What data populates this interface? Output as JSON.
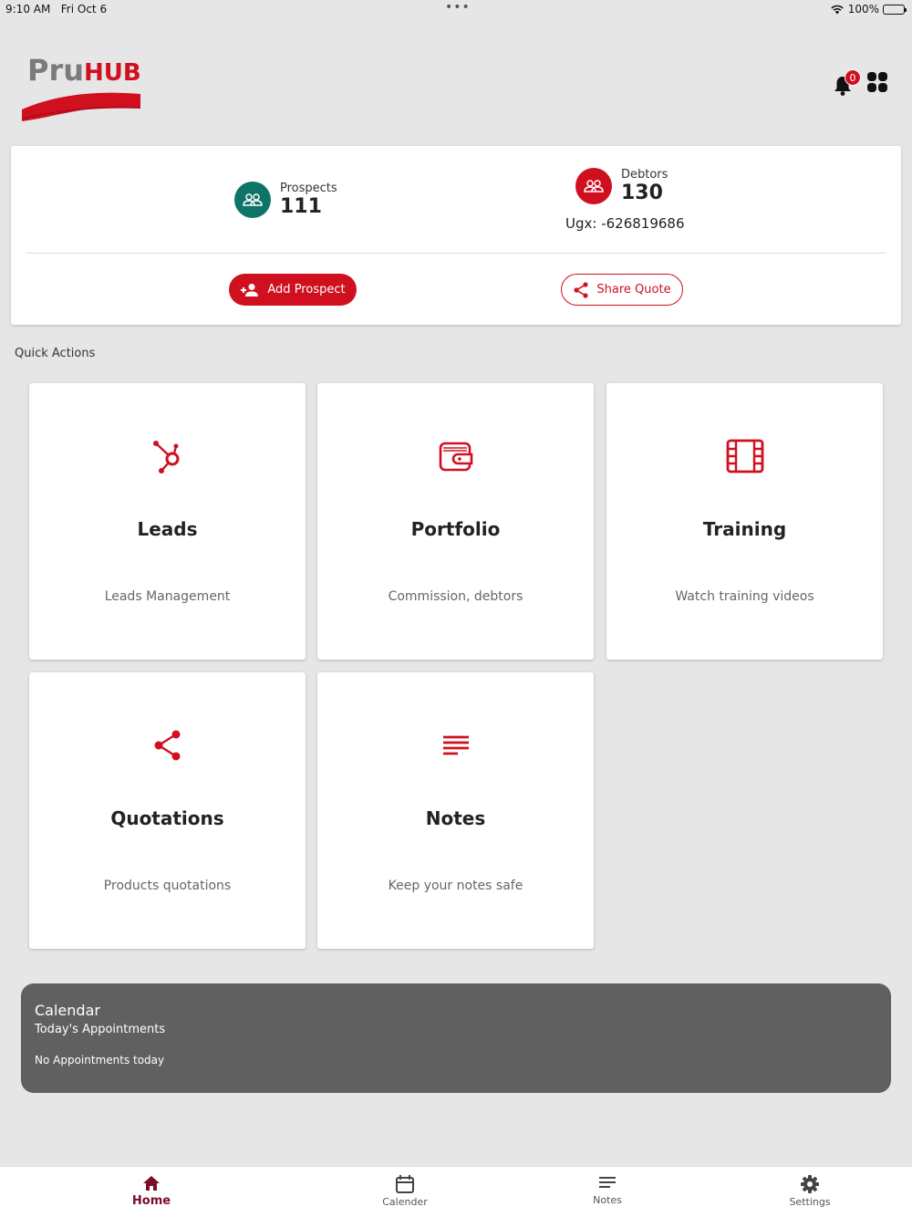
{
  "status_bar": {
    "time": "9:10 AM",
    "date": "Fri Oct 6",
    "battery": "100%",
    "dots": "•••"
  },
  "brand": {
    "part1": "Pru",
    "part2": "HUB",
    "accent": "#d0101f"
  },
  "notifications": {
    "count": "0"
  },
  "summary": {
    "prospects": {
      "label": "Prospects",
      "value": "111",
      "color": "#0e7467"
    },
    "debtors": {
      "label": "Debtors",
      "value": "130",
      "color": "#d0101f",
      "amount": "Ugx: -626819686"
    },
    "add_prospect_label": "Add Prospect",
    "share_quote_label": "Share Quote"
  },
  "quick_actions": {
    "title": "Quick Actions",
    "tiles": [
      {
        "title": "Leads",
        "subtitle": "Leads Management",
        "icon": "hubspot-icon"
      },
      {
        "title": "Portfolio",
        "subtitle": "Commission, debtors",
        "icon": "wallet-icon"
      },
      {
        "title": "Training",
        "subtitle": "Watch training videos",
        "icon": "film-icon"
      },
      {
        "title": "Quotations",
        "subtitle": "Products quotations",
        "icon": "share-icon"
      },
      {
        "title": "Notes",
        "subtitle": "Keep your notes safe",
        "icon": "notes-icon"
      }
    ]
  },
  "calendar": {
    "title": "Calendar",
    "subtitle": "Today's Appointments",
    "empty_text": "No Appointments today"
  },
  "bottom_nav": {
    "items": [
      {
        "label": "Home",
        "icon": "home-icon",
        "active": true
      },
      {
        "label": "Calender",
        "icon": "calendar-icon",
        "active": false
      },
      {
        "label": "Notes",
        "icon": "notes-icon",
        "active": false
      },
      {
        "label": "Settings",
        "icon": "gear-icon",
        "active": false
      }
    ]
  }
}
